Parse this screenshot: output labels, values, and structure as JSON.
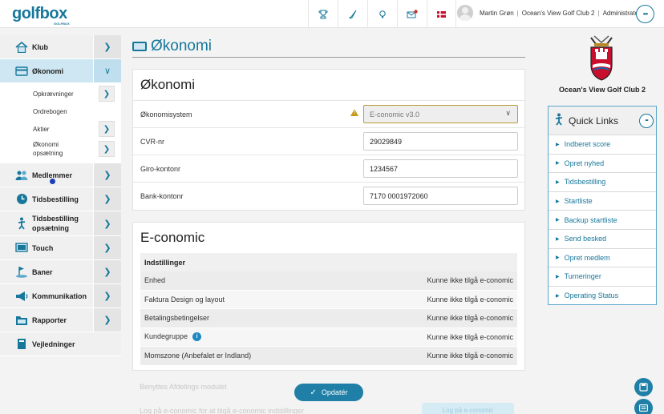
{
  "app": {
    "logo_main": "golfbox",
    "logo_sub": "GOLFBOX"
  },
  "topbar": {
    "icons": [
      "trophy-icon",
      "golf-club-icon",
      "bulb-icon",
      "mail-icon",
      "flag-icon"
    ],
    "user_name": "Martin Grøn",
    "club": "Ocean's View Golf Club 2",
    "role": "Administrator",
    "separator": "|",
    "menu_glyph": "•••"
  },
  "sidebar": {
    "items": [
      {
        "label": "Klub",
        "icon": "house-icon"
      },
      {
        "label": "Økonomi",
        "icon": "card-icon"
      },
      {
        "label": "Medlemmer",
        "icon": "members-icon"
      },
      {
        "label": "Tidsbestilling",
        "icon": "clock-icon"
      },
      {
        "label": "Tidsbestilling opsætning",
        "icon": "golfer-icon"
      },
      {
        "label": "Touch",
        "icon": "touch-icon"
      },
      {
        "label": "Baner",
        "icon": "course-icon"
      },
      {
        "label": "Kommunikation",
        "icon": "megaphone-icon"
      },
      {
        "label": "Rapporter",
        "icon": "folder-icon"
      },
      {
        "label": "Vejledninger",
        "icon": "book-icon"
      }
    ],
    "subitems": [
      {
        "label": "Opkrævninger"
      },
      {
        "label": "Ordrebogen"
      },
      {
        "label": "Aktier"
      },
      {
        "label": "Økonomi opsætning"
      }
    ]
  },
  "page": {
    "title": "Økonomi"
  },
  "okonomi_card": {
    "title": "Økonomi",
    "rows": [
      {
        "label": "Økonomisystem",
        "value": "E-conomic v3.0"
      },
      {
        "label": "CVR-nr",
        "value": "29029849"
      },
      {
        "label": "Giro-kontonr",
        "value": "1234567"
      },
      {
        "label": "Bank-kontonr",
        "value": "7170 0001972060"
      }
    ]
  },
  "economic_card": {
    "title": "E-conomic",
    "settings_header": "Indstillinger",
    "rows": [
      {
        "label": "Enhed",
        "value": "Kunne ikke tilgå e-conomic"
      },
      {
        "label": "Faktura Design og layout",
        "value": "Kunne ikke tilgå e-conomic"
      },
      {
        "label": "Betalingsbetingelser",
        "value": "Kunne ikke tilgå e-conomic"
      },
      {
        "label": "Kundegruppe",
        "value": "Kunne ikke tilgå e-conomic"
      },
      {
        "label": "Momszone (Anbefalet er Indland)",
        "value": "Kunne ikke tilgå e-conomic"
      }
    ],
    "faded_1": "Benyttes Afdelings modulet",
    "faded_2": "Log på e-conomic for at tilgå e-conomic indstillinger",
    "faded_button": "Log på e-conomic"
  },
  "update_button": {
    "label": "Opdatér"
  },
  "club": {
    "name": "Ocean's View Golf Club 2"
  },
  "quick_links": {
    "title": "Quick Links",
    "links": [
      "Indberet score",
      "Opret nyhed",
      "Tidsbestilling",
      "Startliste",
      "Backup startliste",
      "Send besked",
      "Opret medlem",
      "Turneringer",
      "Operating Status"
    ]
  },
  "colors": {
    "brand": "#17779b",
    "active_nav": "#cfe7f2",
    "warning": "#c79a1a",
    "button": "#1f7fa6"
  }
}
